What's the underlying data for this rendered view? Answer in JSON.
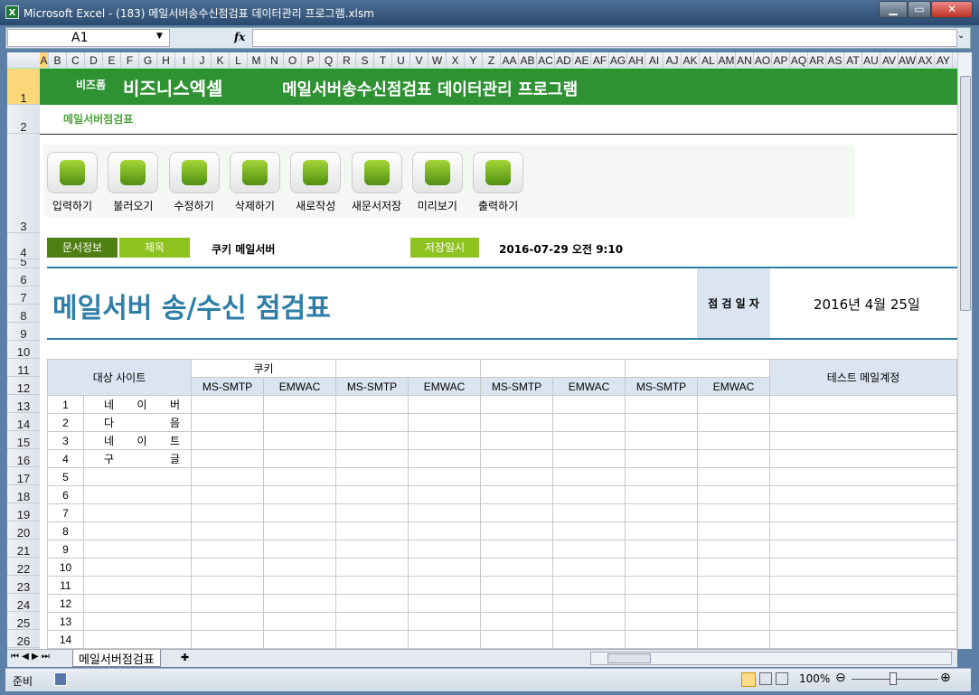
{
  "window": {
    "title": "Microsoft Excel - (183) 메일서버송수신점검표 데이터관리 프로그램.xlsm",
    "minimize": "▁",
    "maximize": "▭",
    "close": "✕"
  },
  "formula_bar": {
    "name_box": "A1",
    "fx": "fx",
    "formula": ""
  },
  "columns": [
    "A",
    "B",
    "C",
    "D",
    "E",
    "F",
    "G",
    "H",
    "I",
    "J",
    "K",
    "L",
    "M",
    "N",
    "O",
    "P",
    "Q",
    "R",
    "S",
    "T",
    "U",
    "V",
    "W",
    "X",
    "Y",
    "Z",
    "AA",
    "AB",
    "AC",
    "AD",
    "AE",
    "AF",
    "AG",
    "AH",
    "AI",
    "AJ",
    "AK",
    "AL",
    "AM",
    "AN",
    "AO",
    "AP",
    "AQ",
    "AR",
    "AS",
    "AT",
    "AU",
    "AV",
    "AW",
    "AX",
    "AY"
  ],
  "rows": [
    "1",
    "2",
    "3",
    "4",
    "5",
    "6",
    "7",
    "8",
    "9",
    "10",
    "11",
    "12",
    "13",
    "14",
    "15",
    "16",
    "17",
    "18",
    "19",
    "20",
    "21",
    "22",
    "23",
    "24",
    "25",
    "26"
  ],
  "banner": {
    "brand_small": "비즈폼",
    "brand": "비즈니스엑셀",
    "title": "메일서버송수신점검표 데이터관리 프로그램"
  },
  "sheet_subtitle": "메일서버점검표",
  "toolbar": [
    {
      "label": "입력하기",
      "icon": "pencil-icon"
    },
    {
      "label": "불러오기",
      "icon": "load-icon"
    },
    {
      "label": "수정하기",
      "icon": "refresh-icon"
    },
    {
      "label": "삭제하기",
      "icon": "trash-icon"
    },
    {
      "label": "새로작성",
      "icon": "new-icon"
    },
    {
      "label": "새문서저장",
      "icon": "save-icon"
    },
    {
      "label": "미리보기",
      "icon": "monitor-icon"
    },
    {
      "label": "출력하기",
      "icon": "print-icon"
    }
  ],
  "doc_info": {
    "label": "문서정보",
    "title_label": "제목",
    "title_value": "쿠키 메일서버",
    "saved_label": "저장일시",
    "saved_value": "2016-07-29  오전 9:10"
  },
  "form": {
    "title": "메일서버 송/수신 점검표",
    "date_label": "점 검 일 자",
    "date_value": "2016년 4월 25일"
  },
  "table": {
    "site_header": "대상 사이트",
    "groups": [
      "쿠키",
      "",
      "",
      ""
    ],
    "sub": [
      "MS-SMTP",
      "EMWAC"
    ],
    "test_header": "테스트 메일계정",
    "rows": [
      [
        "1",
        "네",
        "이",
        "버"
      ],
      [
        "2",
        "다",
        "",
        "음"
      ],
      [
        "3",
        "네",
        "이",
        "트"
      ],
      [
        "4",
        "구",
        "",
        "글"
      ],
      [
        "5"
      ],
      [
        "6"
      ],
      [
        "7"
      ],
      [
        "8"
      ],
      [
        "9"
      ],
      [
        "10"
      ],
      [
        "11"
      ],
      [
        "12"
      ],
      [
        "13"
      ],
      [
        "14"
      ]
    ]
  },
  "sheet_tabs": [
    "메일서버점검표"
  ],
  "status": {
    "ready": "준비",
    "zoom": "100%"
  },
  "colors": {
    "banner": "#2e9132",
    "dark_green": "#4f7f12",
    "light_green": "#8dc21f",
    "accent_blue": "#2e7ea6",
    "header_fill": "#dbe5f1"
  }
}
